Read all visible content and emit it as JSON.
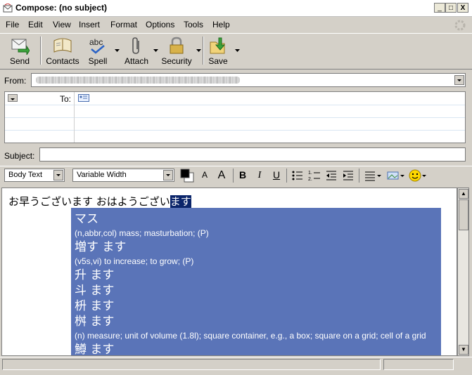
{
  "window": {
    "title": "Compose: (no subject)",
    "minimize": "_",
    "maximize": "□",
    "close": "X"
  },
  "menu": [
    "File",
    "Edit",
    "View",
    "Insert",
    "Format",
    "Options",
    "Tools",
    "Help"
  ],
  "toolbar": {
    "send": "Send",
    "contacts": "Contacts",
    "spell": "Spell",
    "attach": "Attach",
    "security": "Security",
    "save": "Save"
  },
  "from": {
    "label": "From:"
  },
  "recipients": {
    "to_label": "To:"
  },
  "subject": {
    "label": "Subject:",
    "value": ""
  },
  "format_bar": {
    "paragraph_style": "Body Text",
    "font": "Variable Width"
  },
  "body": {
    "text_before": "お早うございます おはようござい",
    "text_selected": "ます"
  },
  "popup": {
    "entries": [
      {
        "kind": "jp",
        "text": "マス"
      },
      {
        "kind": "def",
        "text": "(n,abbr,col) mass; masturbation; (P)"
      },
      {
        "kind": "jp",
        "text": "増す ます"
      },
      {
        "kind": "def",
        "text": "(v5s,vi) to increase; to grow; (P)"
      },
      {
        "kind": "jp",
        "text": "升 ます"
      },
      {
        "kind": "jp",
        "text": "斗 ます"
      },
      {
        "kind": "jp",
        "text": "枡 ます"
      },
      {
        "kind": "jp",
        "text": "桝 ます"
      },
      {
        "kind": "def",
        "text": "(n) measure; unit of volume (1.8l); square container, e.g., a box; square on a grid; cell of a grid"
      },
      {
        "kind": "jp",
        "text": "鱒 ます"
      }
    ]
  },
  "colors": {
    "chrome": "#d4d0c8",
    "popup_bg": "#5a74b8",
    "selection": "#0a246a"
  }
}
